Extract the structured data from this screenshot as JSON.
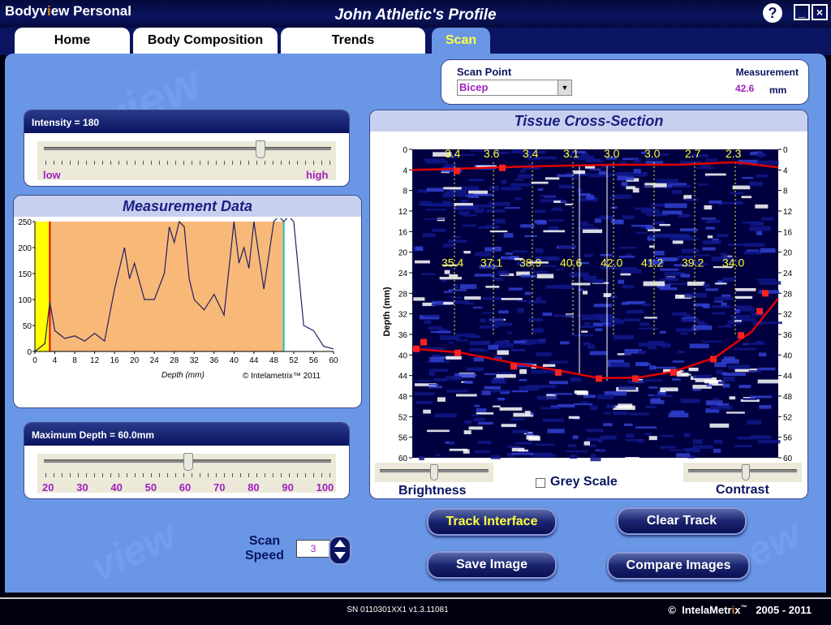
{
  "app": {
    "title_pre": "Bodyv",
    "title_o": "i",
    "title_post": "ew Personal",
    "profile_title": "John Athletic's Profile",
    "help": "?",
    "minimize": "_",
    "close": "×"
  },
  "tabs": [
    {
      "label": "Home"
    },
    {
      "label": "Body Composition"
    },
    {
      "label": "Trends"
    },
    {
      "label": "Scan",
      "active": true
    }
  ],
  "scan_point": {
    "label": "Scan Point",
    "value": "Bicep",
    "measurement_label": "Measurement",
    "measurement_value": "42.6",
    "unit": "mm"
  },
  "intensity": {
    "label": "Intensity = 180",
    "low": "low",
    "high": "high",
    "value": 180
  },
  "measurement_data": {
    "title": "Measurement Data",
    "xlabel": "Depth (mm)",
    "copyright": "© Intelametrix™ 2011"
  },
  "max_depth": {
    "label": "Maximum Depth = 60.0mm",
    "ticks": [
      "20",
      "30",
      "40",
      "50",
      "60",
      "70",
      "80",
      "90",
      "100"
    ],
    "value": 60
  },
  "tissue": {
    "title": "Tissue Cross-Section",
    "ylabel": "Depth (mm)",
    "depth_ticks": [
      "0",
      "4",
      "8",
      "12",
      "16",
      "20",
      "24",
      "28",
      "32",
      "36",
      "40",
      "44",
      "48",
      "52",
      "56",
      "60"
    ],
    "top_values": [
      "3.4",
      "3.6",
      "3.4",
      "3.1",
      "3.0",
      "3.0",
      "2.7",
      "2.3"
    ],
    "mid_values": [
      "35.4",
      "37.1",
      "38.9",
      "40.6",
      "42.0",
      "41.2",
      "39.2",
      "34.0"
    ]
  },
  "controls": {
    "brightness": "Brightness",
    "grey_scale": "Grey Scale",
    "contrast": "Contrast"
  },
  "buttons": {
    "track": "Track Interface",
    "clear": "Clear Track",
    "save": "Save Image",
    "compare": "Compare Images"
  },
  "scan_speed": {
    "label1": "Scan",
    "label2": "Speed",
    "value": "3"
  },
  "footer": {
    "sn": "SN 0110301XX1 v1.3.11081",
    "copyright_sym": "©",
    "brand": "IntelaMetr",
    "brand_x": "i",
    "brand_end": "x",
    "tm": "™",
    "years": "2005 - 2011"
  },
  "chart_data": {
    "type": "line",
    "x": [
      0,
      2,
      3,
      4,
      6,
      8,
      10,
      12,
      14,
      16,
      17,
      18,
      19,
      20,
      22,
      24,
      26,
      27,
      28,
      29,
      30,
      31,
      32,
      34,
      36,
      38,
      40,
      41,
      42,
      43,
      44,
      46,
      48,
      49,
      50,
      51,
      52,
      54,
      56,
      58,
      60
    ],
    "values": [
      0,
      15,
      95,
      40,
      25,
      30,
      20,
      35,
      20,
      120,
      160,
      200,
      140,
      170,
      100,
      100,
      150,
      240,
      210,
      250,
      240,
      140,
      100,
      80,
      110,
      70,
      250,
      170,
      200,
      160,
      250,
      120,
      250,
      260,
      250,
      260,
      250,
      50,
      40,
      10,
      5
    ],
    "xlim": [
      0,
      60
    ],
    "ylim": [
      0,
      250
    ],
    "xticks": [
      "0",
      "4",
      "8",
      "12",
      "16",
      "20",
      "24",
      "28",
      "32",
      "36",
      "40",
      "44",
      "48",
      "52",
      "56",
      "60"
    ],
    "yticks": [
      "0",
      "50",
      "100",
      "150",
      "200",
      "250"
    ],
    "xlabel": "Depth (mm)"
  },
  "colors": {
    "accent": "#ffff40",
    "bg": "#6a96e6",
    "navy": "#0a1460"
  }
}
